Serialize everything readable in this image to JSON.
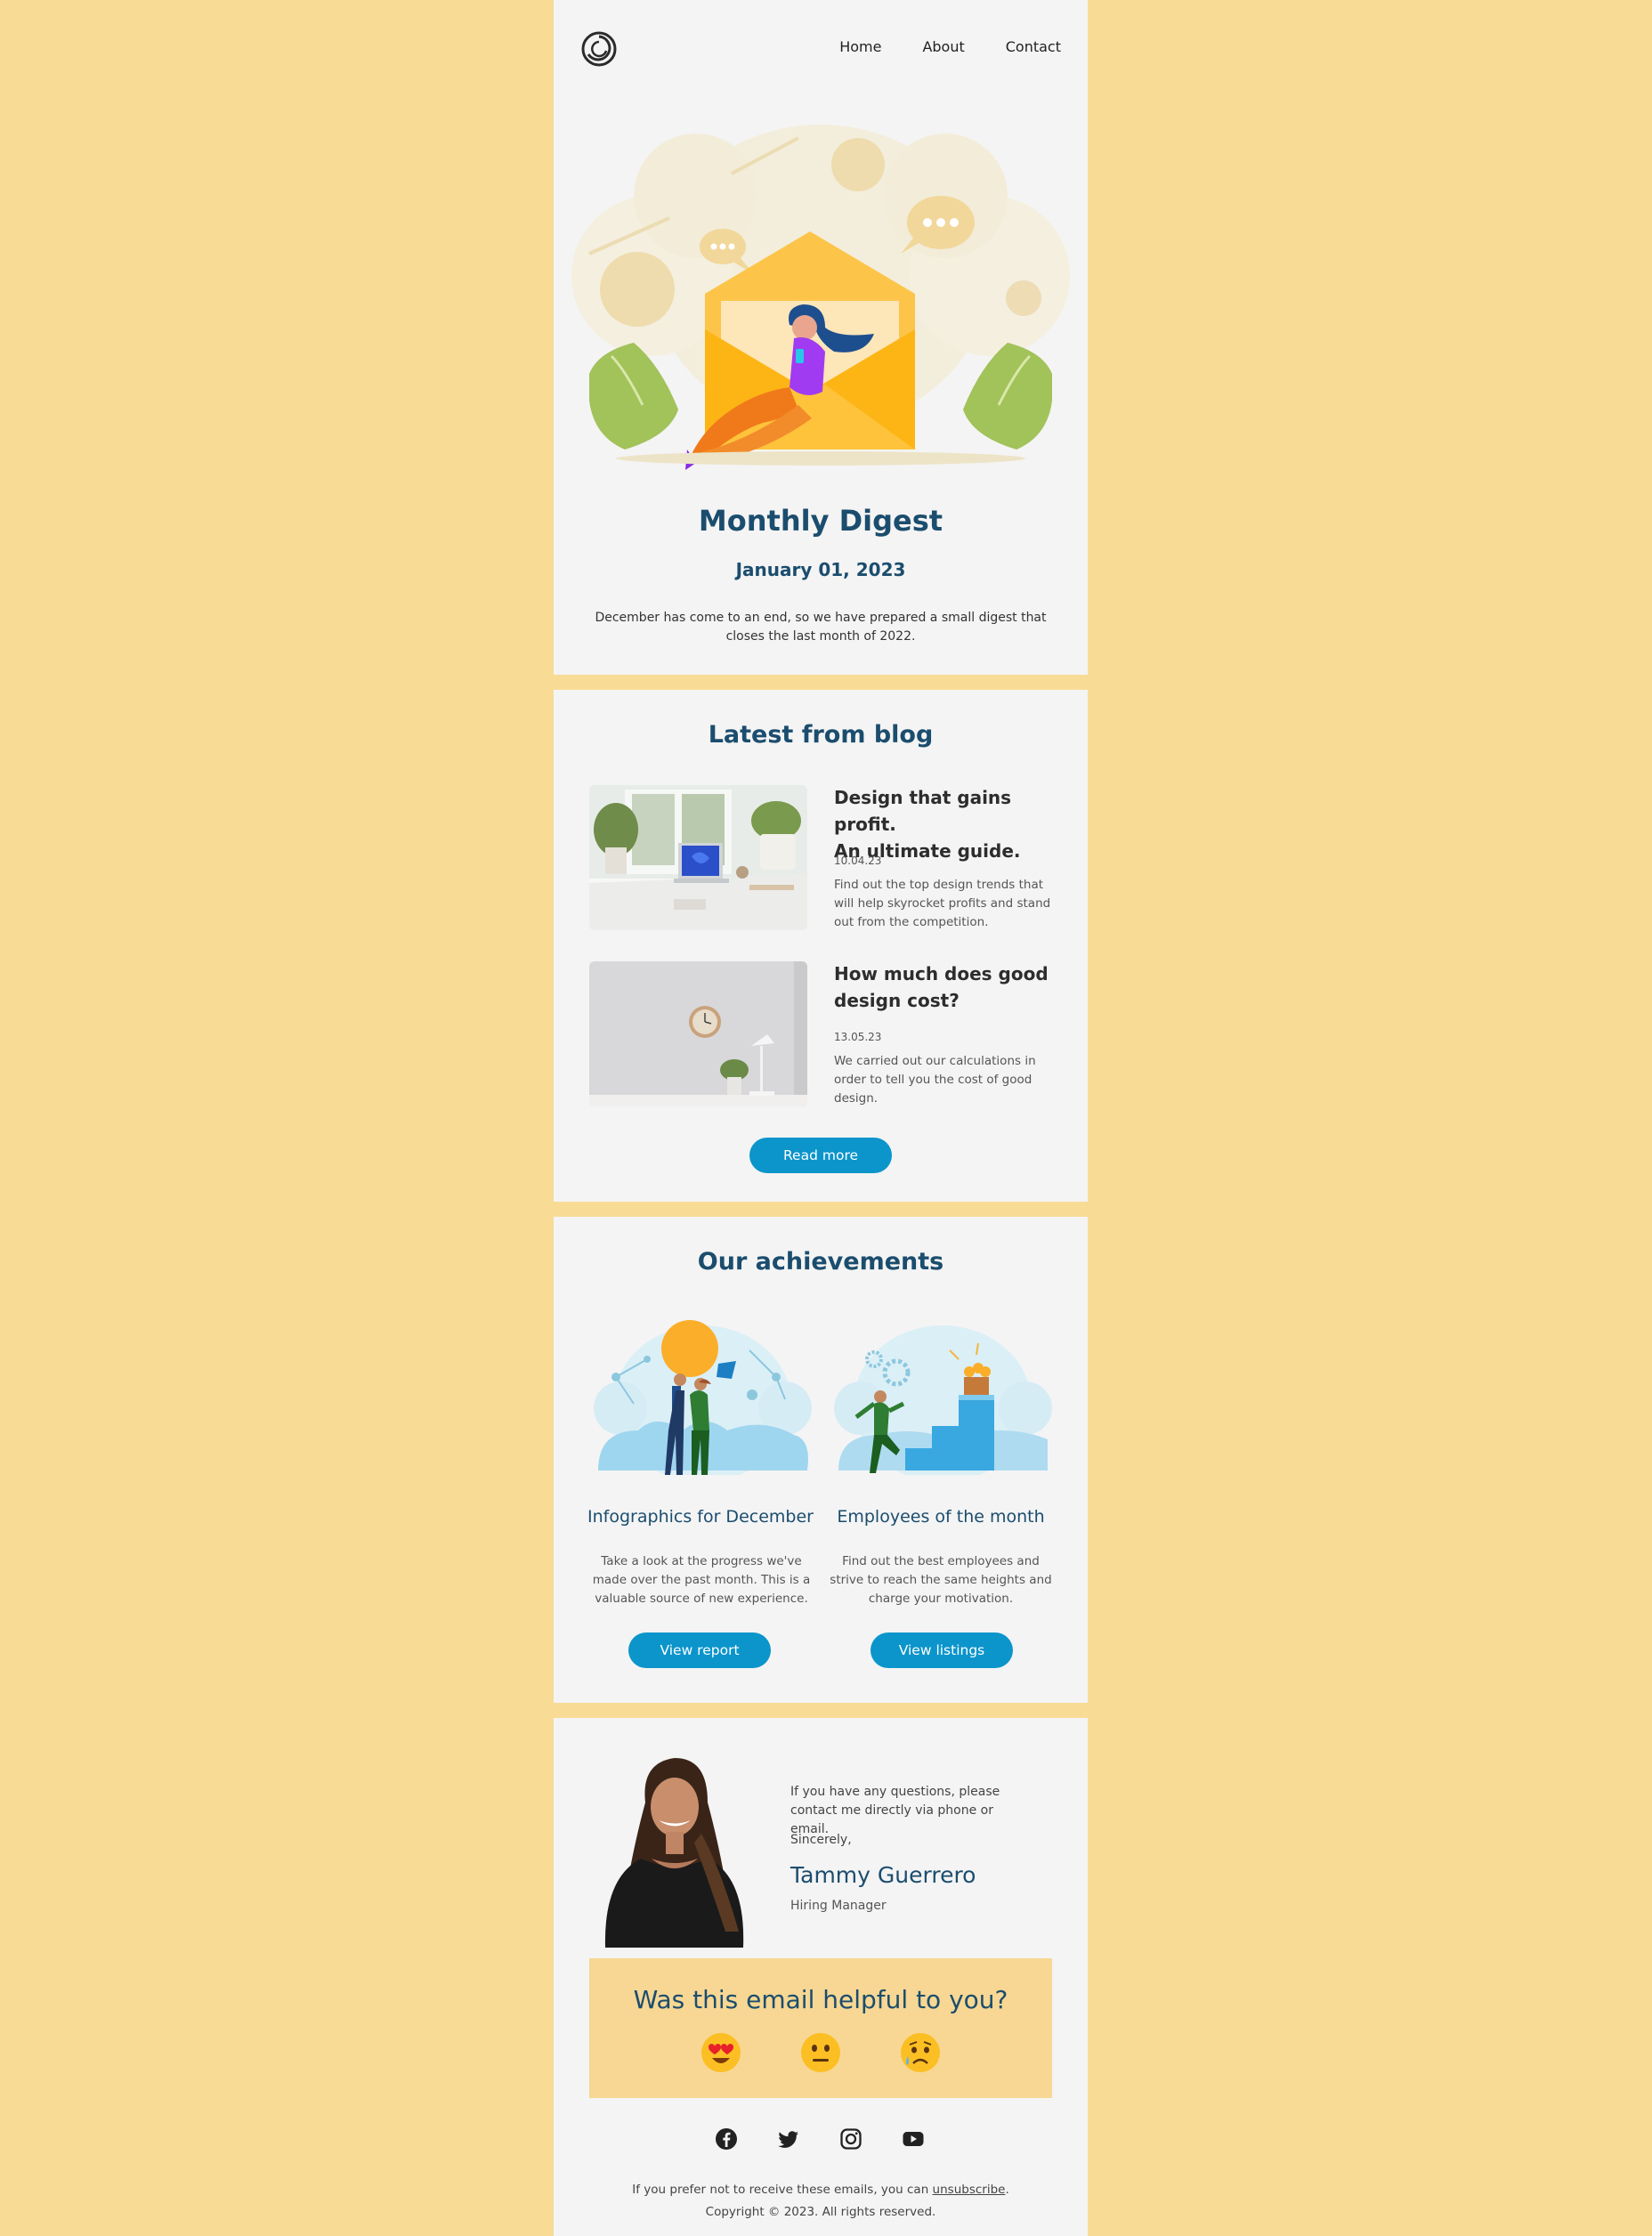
{
  "header": {
    "logo": "logo-ring-icon",
    "nav": [
      "Home",
      "About",
      "Contact"
    ]
  },
  "hero": {
    "title": "Monthly Digest",
    "date": "January 01, 2023",
    "intro": "December has come to an end, so we have prepared a small digest that closes the last month of 2022."
  },
  "blog": {
    "heading": "Latest from blog",
    "posts": [
      {
        "title_line1": "Design that gains profit.",
        "title_line2": "An ultimate guide.",
        "date": "10.04.23",
        "text": "Find out the top design trends that will help skyrocket profits and stand out from the competition."
      },
      {
        "title_line1": "How much does good",
        "title_line2": "design cost?",
        "date": "13.05.23",
        "text": "We carried out our calculations in order to tell you the cost of good design."
      }
    ],
    "button": "Read more"
  },
  "achievements": {
    "heading": "Our achievements",
    "items": [
      {
        "title": "Infographics for December",
        "text": "Take a look at the progress we've made over the past month. This is a valuable source of new experience.",
        "button": "View report"
      },
      {
        "title": "Employees of the month",
        "text": "Find out the best employees and strive to reach the same heights and charge your motivation.",
        "button": "View listings"
      }
    ]
  },
  "contact": {
    "text": "If you have any questions, please contact me directly via phone or email.",
    "closing": "Sincerely,",
    "name": "Tammy Guerrero",
    "role": "Hiring Manager"
  },
  "feedback": {
    "question": "Was this email helpful to you?",
    "options": [
      "heart-eyes-emoji",
      "neutral-face-emoji",
      "sad-tear-emoji"
    ]
  },
  "footer": {
    "social": [
      "facebook-icon",
      "twitter-icon",
      "instagram-icon",
      "youtube-icon"
    ],
    "unsubscribe_prefix": "If you prefer not to receive these emails, you can ",
    "unsubscribe_link": "unsubscribe",
    "unsubscribe_suffix": ".",
    "copyright": "Copyright © 2023. All rights reserved."
  },
  "colors": {
    "background": "#f8dc96",
    "panel": "#f4f4f4",
    "heading": "#1b4d6e",
    "button": "#0b95cb",
    "feedback_bg": "#f7d793"
  }
}
